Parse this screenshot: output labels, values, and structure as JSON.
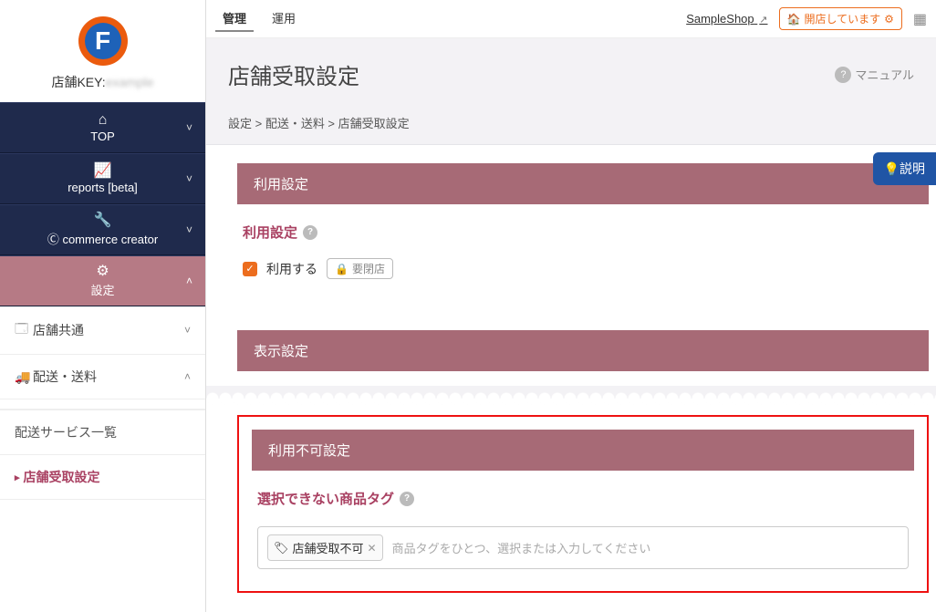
{
  "logo_letter": "F",
  "shopkey": {
    "label": "店舗KEY:",
    "blurred": "example"
  },
  "sidebar": {
    "items": [
      {
        "icon": "home-icon",
        "glyph": "⌂",
        "label": "TOP"
      },
      {
        "icon": "chart-icon",
        "glyph": "📈",
        "label": "reports [beta]"
      },
      {
        "icon": "wrench-icon",
        "glyph": "🔧",
        "label": "commerce creator",
        "prefix": "Ⓒ "
      },
      {
        "icon": "gear-icon",
        "glyph": "⚙",
        "label": "設定",
        "active": true
      }
    ],
    "sub": [
      {
        "icon": "🗔",
        "label": "店舗共通",
        "chev": "˅"
      },
      {
        "icon": "🚚",
        "label": "配送・送料",
        "chev": "˄"
      }
    ],
    "sub2": [
      {
        "label": "配送サービス一覧",
        "current": false
      },
      {
        "label": "店舗受取設定",
        "current": true
      }
    ]
  },
  "topbar": {
    "tab1": "管理",
    "tab2": "運用",
    "shop_link": "SampleShop",
    "open_badge_icon": "🏠",
    "open_badge": "開店しています",
    "open_badge_gear": "⚙"
  },
  "page": {
    "title": "店舗受取設定",
    "manual_label": "マニュアル",
    "breadcrumb": "設定 > 配送・送料 > 店舗受取設定"
  },
  "explain_tab": "💡説明",
  "sections": {
    "usage_bar": "利用設定",
    "usage_label": "利用設定",
    "usage_checkbox_label": "利用する",
    "usage_pill_icon": "🔒",
    "usage_pill": "要閉店",
    "display_bar": "表示設定",
    "disable_bar": "利用不可設定",
    "disable_label": "選択できない商品タグ",
    "tag_chip_icon": "🏷",
    "tag_chip": "店舗受取不可",
    "tag_placeholder": "商品タグをひとつ、選択または入力してください"
  }
}
